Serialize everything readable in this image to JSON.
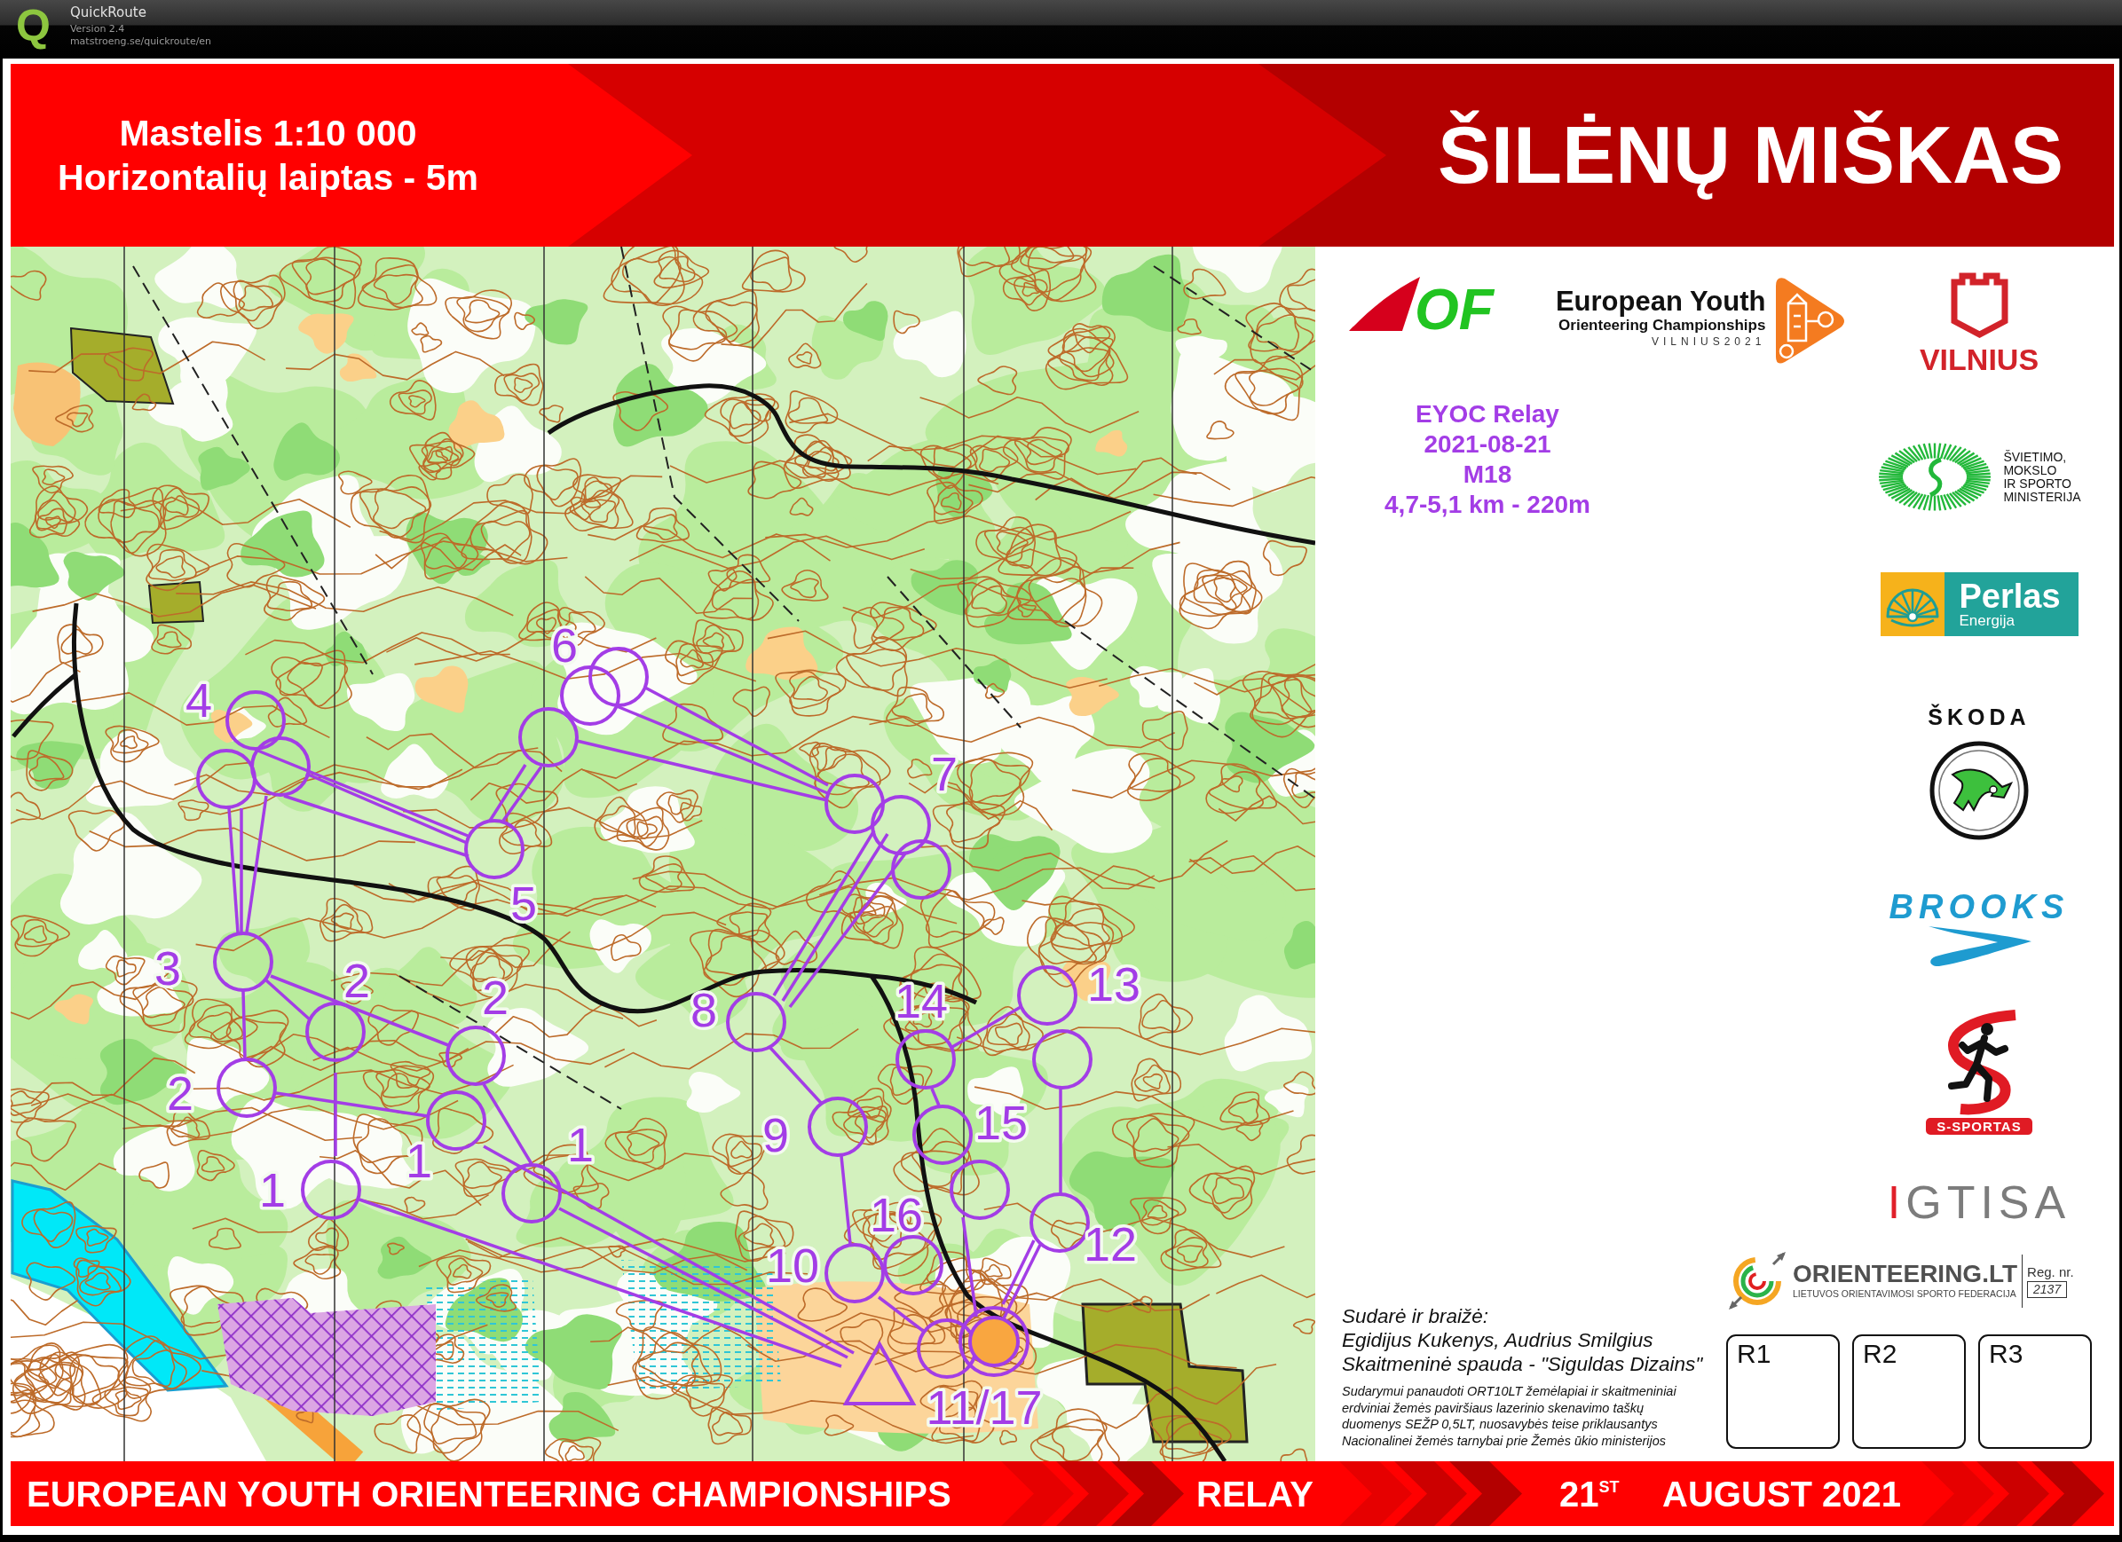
{
  "window": {
    "logo": "Q",
    "title": "QuickRoute",
    "version": "Version 2.4",
    "url": "matstroeng.se/quickroute/en"
  },
  "header": {
    "scale": "Mastelis 1:10 000",
    "contour_interval": "Horizontalių laiptas - 5m",
    "title": "ŠILĖNŲ MIŠKAS"
  },
  "map": {
    "control_numbers": [
      "4",
      "6",
      "7",
      "5",
      "3",
      "2",
      "2",
      "2",
      "1",
      "1",
      "1",
      "8",
      "9",
      "10",
      "11/17",
      "12",
      "13",
      "14",
      "15",
      "16"
    ]
  },
  "logos": {
    "iof": "OF",
    "eyoc": {
      "name": "European Youth",
      "subtitle": "Orienteering Championships",
      "place": "VILNIUS2021"
    },
    "vilnius": "VILNIUS",
    "ministry": [
      "ŠVIETIMO,",
      "MOKSLO",
      "IR SPORTO",
      "MINISTERIJA"
    ],
    "perlas": {
      "name": "Perlas",
      "tagline": "Energija"
    },
    "skoda": "ŠKODA",
    "brooks": "BROOKS",
    "s_sportas": "S-SPORTAS",
    "igtisa": "IGTISA",
    "federation": {
      "name": "ORIENTEERING.LT",
      "subtitle": "LIETUVOS ORIENTAVIMOSI SPORTO FEDERACIJA",
      "reg_label": "Reg. nr.",
      "reg_number": "2137"
    }
  },
  "course_info": {
    "title": "EYOC Relay",
    "date": "2021-08-21",
    "class": "M18",
    "length": "4,7-5,1 km - 220m"
  },
  "credits": {
    "heading": "Sudarė ir braižė:",
    "authors": "Egidijus Kukenys, Audrius Smilgius",
    "print": "Skaitmeninė spauda - \"Siguldas Dizains\"",
    "note_lines": [
      "Sudarymui panaudoti ORT10LT žemėlapiai ir skaitmeniniai",
      "erdviniai žemės paviršiaus lazerinio skenavimo taškų",
      "duomenys SEŽP 0,5LT, nuosavybės teise priklausantys",
      "Nacionalinei žemės tarnybai prie Žemės ūkio ministerijos"
    ]
  },
  "punch_boxes": [
    "R1",
    "R2",
    "R3"
  ],
  "footer": {
    "event": "EUROPEAN YOUTH ORIENTEERING CHAMPIONSHIPS",
    "discipline": "RELAY",
    "day": "21$^{ST}$",
    "month_year": "AUGUST 2021"
  }
}
